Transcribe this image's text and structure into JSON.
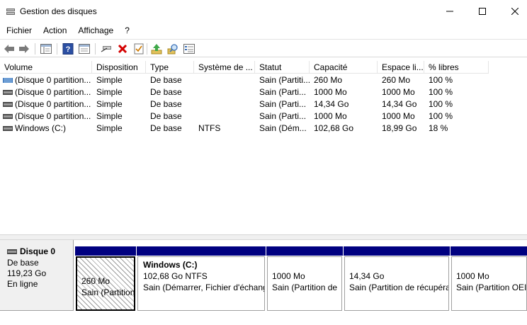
{
  "window": {
    "title": "Gestion des disques",
    "controls": {
      "minimize_icon": "minimize-icon",
      "maximize_icon": "maximize-icon",
      "close_icon": "close-icon"
    }
  },
  "menu": [
    "Fichier",
    "Action",
    "Affichage",
    "?"
  ],
  "toolbar": {
    "icons": [
      "back-arrow-icon",
      "forward-arrow-icon",
      "console-tree-icon",
      "help-icon",
      "properties-icon",
      "connect-disk-icon",
      "delete-icon",
      "checklist-icon",
      "upload-icon",
      "search-icon",
      "settings-list-icon"
    ]
  },
  "volume_list": {
    "columns": [
      "Volume",
      "Disposition",
      "Type",
      "Système de ...",
      "Statut",
      "Capacité",
      "Espace li...",
      "% libres"
    ],
    "rows": [
      {
        "volume": "(Disque 0 partition...",
        "disposition": "Simple",
        "type": "De base",
        "fs": "",
        "status": "Sain (Partiti...",
        "capacity": "260 Mo",
        "free": "260 Mo",
        "pct": "100 %"
      },
      {
        "volume": "(Disque 0 partition...",
        "disposition": "Simple",
        "type": "De base",
        "fs": "",
        "status": "Sain (Parti...",
        "capacity": "1000 Mo",
        "free": "1000 Mo",
        "pct": "100 %"
      },
      {
        "volume": "(Disque 0 partition...",
        "disposition": "Simple",
        "type": "De base",
        "fs": "",
        "status": "Sain (Parti...",
        "capacity": "14,34 Go",
        "free": "14,34 Go",
        "pct": "100 %"
      },
      {
        "volume": "(Disque 0 partition...",
        "disposition": "Simple",
        "type": "De base",
        "fs": "",
        "status": "Sain (Parti...",
        "capacity": "1000 Mo",
        "free": "1000 Mo",
        "pct": "100 %"
      },
      {
        "volume": "Windows (C:)",
        "disposition": "Simple",
        "type": "De base",
        "fs": "NTFS",
        "status": "Sain (Dém...",
        "capacity": "102,68 Go",
        "free": "18,99 Go",
        "pct": "18 %"
      }
    ]
  },
  "disk": {
    "title": "Disque 0",
    "type": "De base",
    "size": "119,23 Go",
    "state": "En ligne",
    "partitions": [
      {
        "name": "",
        "size": "260 Mo",
        "status": "Sain (Partition"
      },
      {
        "name": "Windows  (C:)",
        "size": "102,68 Go NTFS",
        "status": "Sain (Démarrer, Fichier d'échang"
      },
      {
        "name": "",
        "size": "1000 Mo",
        "status": "Sain (Partition de"
      },
      {
        "name": "",
        "size": "14,34 Go",
        "status": "Sain (Partition de récupéra"
      },
      {
        "name": "",
        "size": "1000 Mo",
        "status": "Sain (Partition OEI"
      }
    ]
  },
  "colors": {
    "partition_bar": "#000080",
    "accent_blue": "#1f5fb8",
    "delete_red": "#d40000"
  }
}
